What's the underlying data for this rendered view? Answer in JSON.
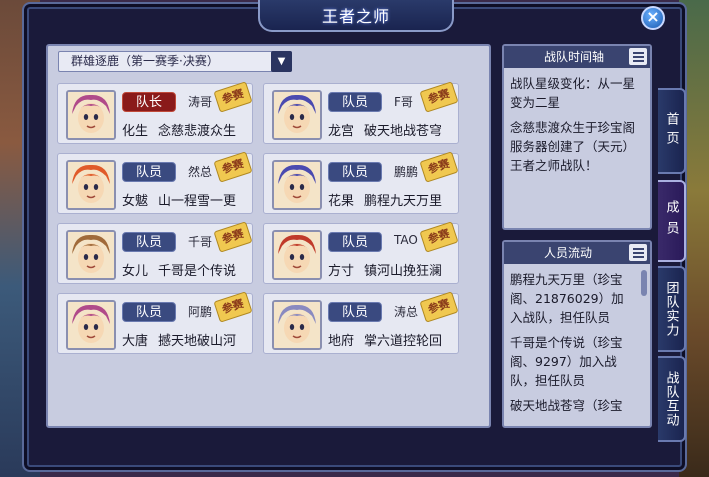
{
  "window": {
    "title": "王者之师"
  },
  "dropdown": {
    "selected": "群雄逐鹿（第一赛季·决赛）"
  },
  "stamp_label": "参赛",
  "members": [
    {
      "role": "队长",
      "role_type": "leader",
      "name": "涛哥",
      "school": "化生",
      "character": "念慈悲渡众生",
      "avatar_color": "#b04a8a"
    },
    {
      "role": "队员",
      "role_type": "member",
      "name": "F哥",
      "school": "龙宫",
      "character": "破天地战苍穹",
      "avatar_color": "#4a4ab0"
    },
    {
      "role": "队员",
      "role_type": "member",
      "name": "然总",
      "school": "女魃",
      "character": "山一程雪一更",
      "avatar_color": "#e05a2a"
    },
    {
      "role": "队员",
      "role_type": "member",
      "name": "鹏鹏",
      "school": "花果",
      "character": "鹏程九天万里",
      "avatar_color": "#4a4ab0"
    },
    {
      "role": "队员",
      "role_type": "member",
      "name": "千哥",
      "school": "女儿",
      "character": "千哥是个传说",
      "avatar_color": "#a06a3a"
    },
    {
      "role": "队员",
      "role_type": "member",
      "name": "TAO",
      "school": "方寸",
      "character": "镇河山挽狂澜",
      "avatar_color": "#c03a2a"
    },
    {
      "role": "队员",
      "role_type": "member",
      "name": "阿鹏",
      "school": "大唐",
      "character": "撼天地破山河",
      "avatar_color": "#b04a8a"
    },
    {
      "role": "队员",
      "role_type": "member",
      "name": "涛总",
      "school": "地府",
      "character": "掌六道控轮回",
      "avatar_color": "#8a8ac0"
    }
  ],
  "timeline": {
    "title": "战队时间轴",
    "entries": [
      "战队星级变化：从一星变为二星",
      "念慈悲渡众生于珍宝阁服务器创建了（天元）王者之师战队！"
    ]
  },
  "roster_flow": {
    "title": "人员流动",
    "entries": [
      "鹏程九天万里（珍宝阁、21876029）加入战队，担任队员",
      "千哥是个传说（珍宝阁、9297）加入战队，担任队员",
      "破天地战苍穹（珍宝"
    ]
  },
  "tabs": [
    {
      "label": "首页",
      "active": false
    },
    {
      "label": "成员",
      "active": true
    },
    {
      "label": "团队实力",
      "active": false
    },
    {
      "label": "战队互动",
      "active": false
    }
  ]
}
